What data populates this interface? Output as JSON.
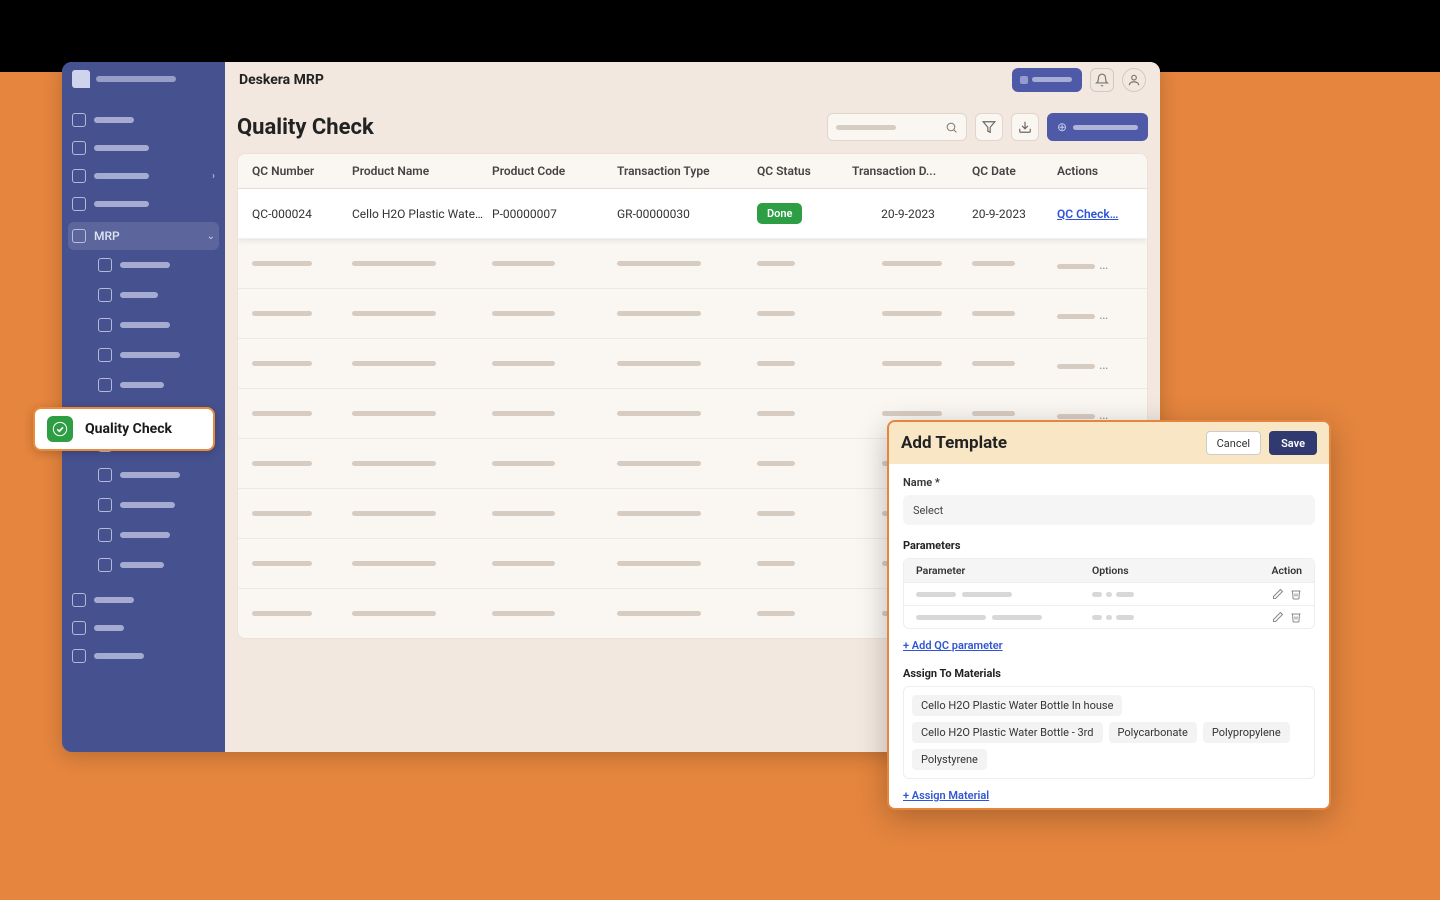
{
  "app": {
    "title": "Deskera MRP"
  },
  "sidebar": {
    "active_label": "MRP"
  },
  "page": {
    "title": "Quality Check"
  },
  "table": {
    "headers": [
      "QC Number",
      "Product Name",
      "Product Code",
      "Transaction Type",
      "QC Status",
      "Transaction D...",
      "QC Date",
      "Actions"
    ],
    "row": {
      "qc_number": "QC-000024",
      "product_name": "Cello H2O Plastic Water...",
      "product_code": "P-00000007",
      "transaction_type": "GR-00000030",
      "status": "Done",
      "transaction_date": "20-9-2023",
      "qc_date": "20-9-2023",
      "action_link": "QC Check"
    }
  },
  "callout": {
    "label": "Quality Check"
  },
  "modal": {
    "title": "Add Template",
    "cancel": "Cancel",
    "save": "Save",
    "name_label": "Name *",
    "name_placeholder": "Select",
    "parameters_label": "Parameters",
    "param_headers": {
      "param": "Parameter",
      "options": "Options",
      "action": "Action"
    },
    "add_param": "+ Add QC parameter",
    "assign_label": "Assign To Materials",
    "chips": [
      "Cello H2O Plastic Water Bottle In house",
      "Cello H2O Plastic Water Bottle - 3rd",
      "Polycarbonate",
      "Polypropylene",
      "Polystyrene"
    ],
    "assign_material": "+ Assign Material"
  }
}
